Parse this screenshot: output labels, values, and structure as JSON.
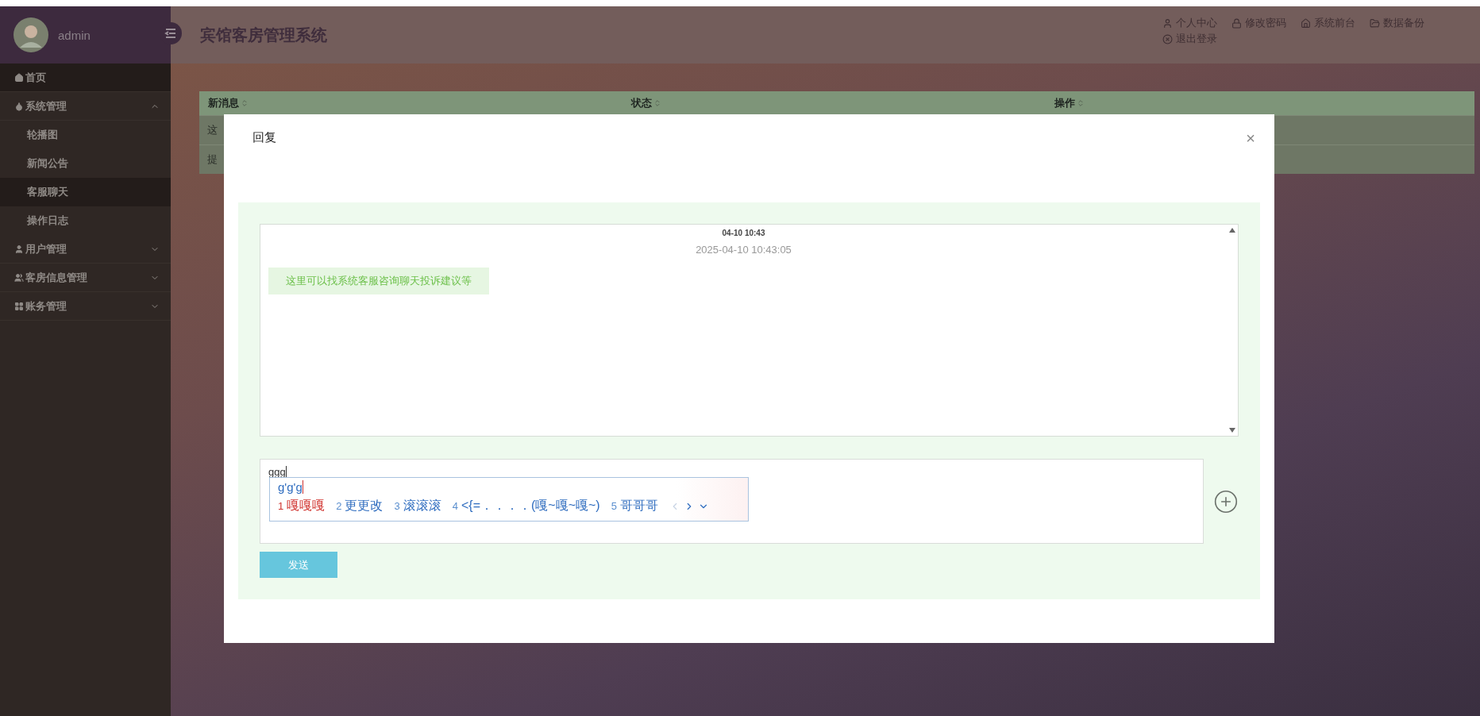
{
  "sidebar": {
    "user": "admin",
    "items": [
      {
        "label": "首页",
        "selected": true
      },
      {
        "label": "系统管理",
        "selected": false,
        "expanded": true,
        "children": [
          {
            "label": "轮播图",
            "selected": false
          },
          {
            "label": "新闻公告",
            "selected": false
          },
          {
            "label": "客服聊天",
            "selected": true
          },
          {
            "label": "操作日志",
            "selected": false
          }
        ]
      },
      {
        "label": "用户管理",
        "selected": false,
        "expanded": false
      },
      {
        "label": "客房信息管理",
        "selected": false,
        "expanded": false
      },
      {
        "label": "账务管理",
        "selected": false,
        "expanded": false
      }
    ]
  },
  "header": {
    "title": "宾馆客房管理系统",
    "links": [
      "个人中心",
      "修改密码",
      "系统前台",
      "数据备份",
      "退出登录"
    ]
  },
  "table": {
    "columns": [
      "新消息",
      "状态",
      "操作"
    ],
    "rows": [
      {
        "column_1": "这"
      },
      {
        "column_1": "提"
      }
    ]
  },
  "dialog": {
    "title": "回复",
    "close": "×",
    "chat": {
      "header": "04-10 10:43",
      "time": "2025-04-10 10:43:05",
      "messages": [
        "这里可以找系统客服咨询聊天投诉建议等"
      ]
    },
    "input": {
      "value": "ggg"
    },
    "ime": {
      "composition": "g'g'g",
      "candidates": [
        {
          "number": "1",
          "text": "嘎嘎嘎",
          "selected": true
        },
        {
          "number": "2",
          "text": "更更改",
          "selected": false
        },
        {
          "number": "3",
          "text": "滚滚滚",
          "selected": false
        },
        {
          "number": "4",
          "text": "<{=．．．．(嘎~嘎~嘎~)",
          "selected": false
        },
        {
          "number": "5",
          "text": "哥哥哥",
          "selected": false
        }
      ]
    },
    "send": "发送"
  }
}
